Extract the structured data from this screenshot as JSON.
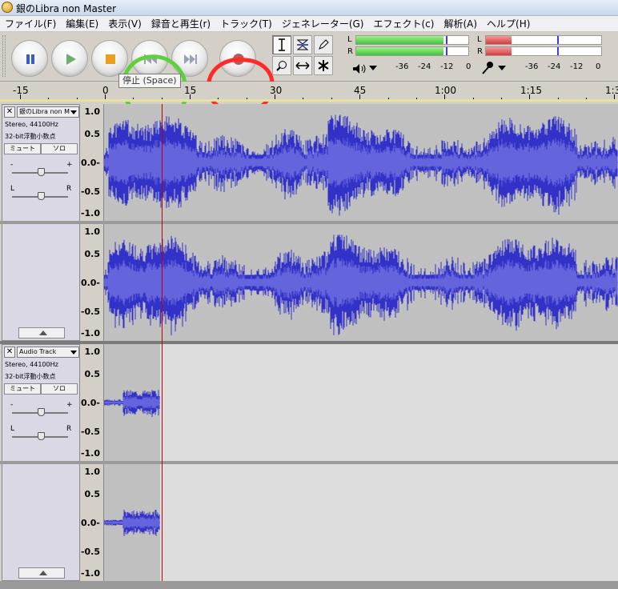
{
  "window": {
    "title": "銀のLibra non Master"
  },
  "menu": [
    "ファイル(F)",
    "編集(E)",
    "表示(V)",
    "録音と再生(r)",
    "トラック(T)",
    "ジェネレーター(G)",
    "エフェクト(c)",
    "解析(A)",
    "ヘルプ(H)"
  ],
  "transport": {
    "pause": "pause-icon",
    "play": "play-icon",
    "stop": "stop-icon",
    "skip_start": "skip-to-start-icon",
    "skip_end": "skip-to-end-icon",
    "record": "record-icon"
  },
  "tooltip": "停止 (Space)",
  "meters": {
    "playback": {
      "channels": [
        "L",
        "R"
      ],
      "level_fraction": 0.78,
      "peak_fraction": 0.8,
      "ticks": [
        "-36",
        "-24",
        "-12",
        "0"
      ]
    },
    "record": {
      "channels": [
        "L",
        "R"
      ],
      "level_fraction": 0.22,
      "peak_fraction": 0.62,
      "ticks": [
        "-36",
        "-24",
        "-12",
        "0"
      ]
    },
    "colors": {
      "play": "#3fc43a",
      "record": "#d63a3a",
      "peak": "#3a3aff"
    }
  },
  "ruler": {
    "labels": [
      "-15",
      "0",
      "15",
      "30",
      "45",
      "1:00",
      "1:15",
      "1:3"
    ]
  },
  "tracks": [
    {
      "name": "銀のLibra non M",
      "format": "Stereo, 44100Hz",
      "sample": "32-bit浮動小数点",
      "mute": "ミュート",
      "solo": "ソロ",
      "gain_minus": "-",
      "gain_plus": "+",
      "pan_left": "L",
      "pan_right": "R",
      "amplitude_labels": [
        "1.0",
        "0.5",
        "0.0-",
        "-0.5",
        "-1.0"
      ]
    },
    {
      "name": "Audio Track",
      "format": "Stereo, 44100Hz",
      "sample": "32-bit浮動小数点",
      "mute": "ミュート",
      "solo": "ソロ",
      "gain_minus": "-",
      "gain_plus": "+",
      "pan_left": "L",
      "pan_right": "R",
      "amplitude_labels": [
        "1.0",
        "0.5",
        "0.0-",
        "-0.5",
        "-1.0"
      ]
    }
  ],
  "colors": {
    "wave": "#3232c8",
    "wave_rms": "#6464dc",
    "cursor": "#c00000",
    "annot_green": "#5fcf3c",
    "annot_red": "#ff2a2a"
  }
}
